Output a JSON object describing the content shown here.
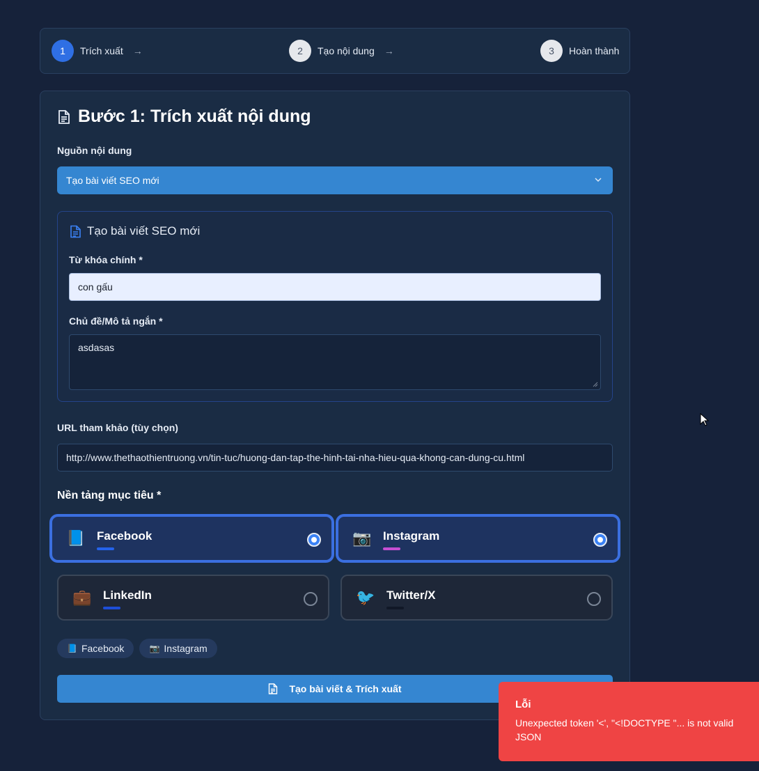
{
  "stepper": {
    "steps": [
      {
        "number": "1",
        "label": "Trích xuất",
        "active": true
      },
      {
        "number": "2",
        "label": "Tạo nội dung",
        "active": false
      },
      {
        "number": "3",
        "label": "Hoàn thành",
        "active": false
      }
    ],
    "arrow": "→"
  },
  "card": {
    "title": "Bước 1: Trích xuất nội dung",
    "title_icon": "document-icon",
    "source_label": "Nguồn nội dung",
    "source_value": "Tạo bài viết SEO mới",
    "seo_panel": {
      "title": "Tạo bài viết SEO mới",
      "keyword_label": "Từ khóa chính *",
      "keyword_value": "con gấu",
      "topic_label": "Chủ đề/Mô tả ngắn *",
      "topic_value": "asdasas"
    },
    "url_label": "URL tham khảo (tùy chọn)",
    "url_value": "http://www.thethaothientruong.vn/tin-tuc/huong-dan-tap-the-hinh-tai-nha-hieu-qua-khong-can-dung-cu.html",
    "platform_title": "Nền tảng mục tiêu *",
    "platforms": [
      {
        "name": "Facebook",
        "emoji": "📘",
        "icon": "facebook-book-icon",
        "bar_color": "#2563eb",
        "selected": true
      },
      {
        "name": "Instagram",
        "emoji": "📷",
        "icon": "camera-icon",
        "bar_color": "#c74fd3",
        "selected": true
      },
      {
        "name": "LinkedIn",
        "emoji": "💼",
        "icon": "briefcase-icon",
        "bar_color": "#1d4ed8",
        "selected": false
      },
      {
        "name": "Twitter/X",
        "emoji": "🐦",
        "icon": "bird-icon",
        "bar_color": "#111827",
        "selected": false
      }
    ],
    "chips": [
      {
        "emoji": "📘",
        "label": "Facebook"
      },
      {
        "emoji": "📷",
        "label": "Instagram"
      }
    ],
    "submit_label": "Tạo bài viết & Trích xuất"
  },
  "toast": {
    "title": "Lỗi",
    "message": "Unexpected token '<', \"<!DOCTYPE \"... is not valid JSON",
    "color": "#ef4444"
  }
}
